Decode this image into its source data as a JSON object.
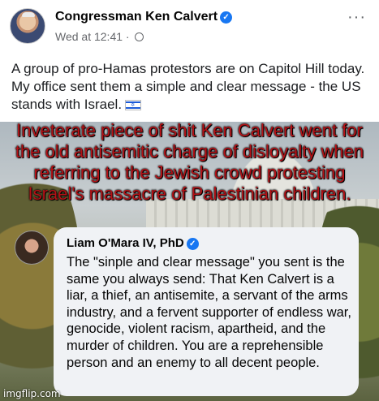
{
  "post": {
    "author": "Congressman Ken Calvert",
    "timestamp": "Wed at 12:41",
    "audience_icon": "globe-icon",
    "text": "A group of pro-Hamas protestors are on Capitol Hill today. My office sent them a simple and clear message - the US stands with Israel.",
    "flag_icon": "israel-flag-icon",
    "more_label": "···"
  },
  "meme": {
    "caption": "Inveterate piece of shit Ken Calvert went for the old antisemitic charge of disloyalty when referring to the Jewish crowd protesting Israel's massacre of Palestinian children."
  },
  "comment": {
    "author": "Liam O'Mara IV, PhD",
    "text": "The \"sinple and clear message\" you sent is the same you always send: That Ken Calvert is a liar, a thief, an antisemite, a servant of the arms industry, and a fervent supporter of endless war, genocide, violent racism, apartheid, and the murder of children. You are a reprehensible person and an enemy to all decent people."
  },
  "watermark": "imgflip.com",
  "colors": {
    "verified": "#1877f2",
    "caption": "#b31217",
    "muted": "#65676b",
    "bubble": "#f0f2f5"
  }
}
